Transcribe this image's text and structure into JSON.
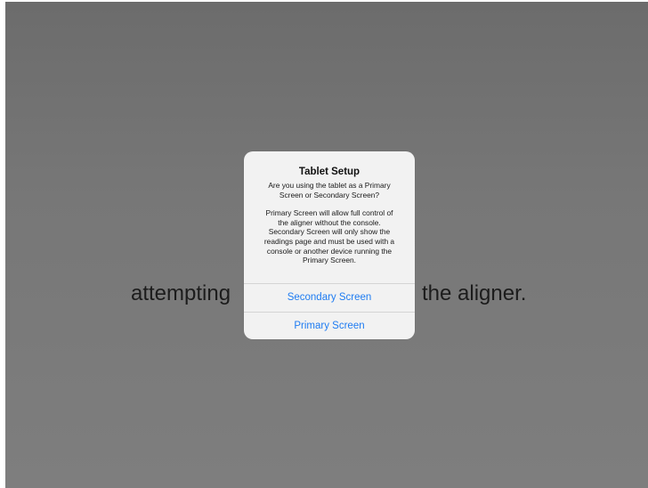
{
  "background": {
    "text_left": "attempting",
    "text_right": "the aligner."
  },
  "alert": {
    "title": "Tablet Setup",
    "message_lines": [
      "Are you using the tablet as a Primary",
      "Screen  or Secondary Screen?",
      "",
      "Primary Screen will allow full control of",
      "the aligner without the console.",
      "Secondary Screen will only show the",
      "readings page and must be used with a",
      "console or another device running the",
      "Primary Screen."
    ],
    "buttons": {
      "secondary_label": "Secondary Screen",
      "primary_label": "Primary Screen"
    }
  },
  "colors": {
    "button_text": "#1f7cf2",
    "overlay": "#777777",
    "alert_background": "#f2f2f2"
  }
}
